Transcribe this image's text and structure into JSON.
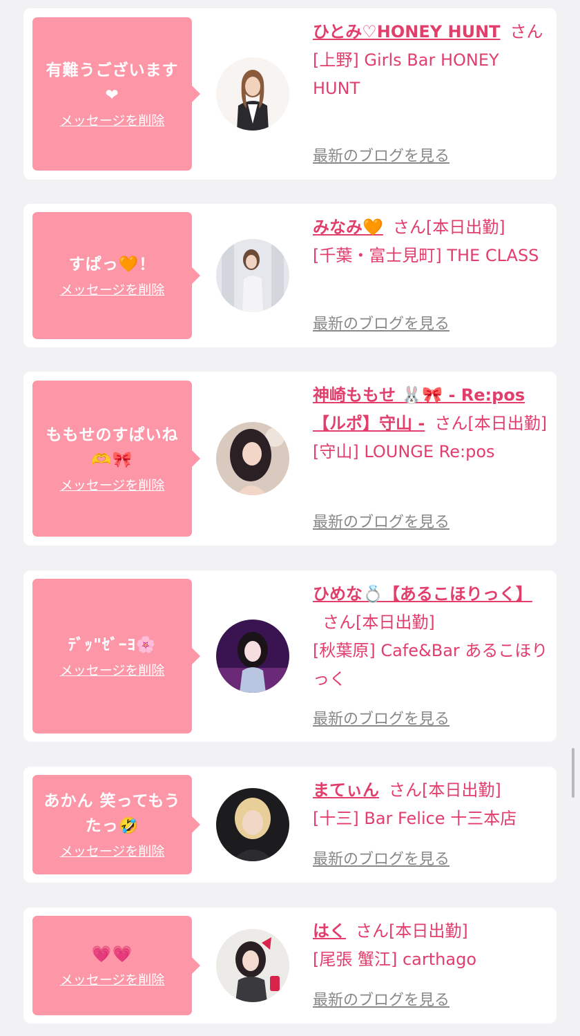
{
  "common": {
    "delete_label": "メッセージを削除",
    "blog_label": "最新のブログを見る"
  },
  "colors": {
    "bubble": "#fd97a8",
    "accent": "#e23e6b",
    "blog_link": "#888888",
    "background": "#f2f2f4"
  },
  "cards": [
    {
      "message": "有難うございます❤",
      "name": "ひとみ♡HONEY HUNT",
      "suffix": "さん",
      "shop": "[上野] Girls Bar HONEY HUNT",
      "avatar_icon": "avatar-photo-woman-black-vest"
    },
    {
      "message": "すぱっ🧡！",
      "name": "みなみ🧡",
      "suffix": "さん[本日出勤]",
      "shop": "[千葉・富士見町] THE CLASS",
      "avatar_icon": "avatar-photo-woman-white-dress"
    },
    {
      "message": "ももせのすぱいね🫶🎀",
      "name": "神崎ももせ 🐰🎀 - Re:pos 【ルポ】守山 -",
      "suffix": "さん[本日出勤]",
      "shop": "[守山] LOUNGE Re:pos",
      "avatar_icon": "avatar-photo-woman-dark-hair"
    },
    {
      "message": "ﾃﾞｯ\"ｾﾞｰﾖ🌸",
      "name": "ひめな💍【あるこほりっく】",
      "suffix": "さん[本日出勤]",
      "shop": "[秋葉原] Cafe&Bar あるこほりっく",
      "avatar_icon": "avatar-photo-woman-purple-background"
    },
    {
      "message": "あかん 笑ってもうたっ🤣",
      "name": "まてぃん",
      "suffix": "さん[本日出勤]",
      "shop": "[十三] Bar Felice 十三本店",
      "avatar_icon": "avatar-photo-woman-blonde"
    },
    {
      "message": "💗💗",
      "name": "はく",
      "suffix": "さん[本日出勤]",
      "shop": "[尾張 蟹江] carthago",
      "avatar_icon": "avatar-photo-woman-red-bow"
    }
  ]
}
